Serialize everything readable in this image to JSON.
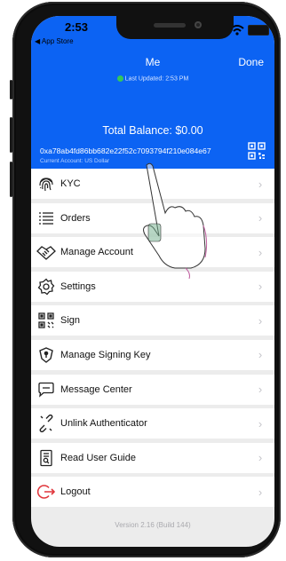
{
  "status_bar": {
    "time": "2:53",
    "back_app": "◀ App Store"
  },
  "nav": {
    "title": "Me",
    "done_label": "Done"
  },
  "header": {
    "last_updated": "Last Updated: 2:53 PM",
    "total_balance": "Total Balance: $0.00",
    "address": "0xa78ab4fd86bb682e22f52c7093794f210e084e67",
    "current_account": "Current Account: US Dollar"
  },
  "menu": {
    "items": [
      {
        "label": "KYC",
        "icon": "fingerprint-icon"
      },
      {
        "label": "Orders",
        "icon": "list-icon"
      },
      {
        "label": "Manage Account",
        "icon": "handshake-icon"
      },
      {
        "label": "Settings",
        "icon": "gear-icon"
      },
      {
        "label": "Sign",
        "icon": "qr-scan-icon"
      },
      {
        "label": "Manage Signing Key",
        "icon": "key-shield-icon"
      },
      {
        "label": "Message Center",
        "icon": "message-icon"
      },
      {
        "label": "Unlink Authenticator",
        "icon": "unlink-icon"
      },
      {
        "label": "Read User Guide",
        "icon": "guide-icon"
      },
      {
        "label": "Logout",
        "icon": "logout-icon"
      }
    ]
  },
  "footer": {
    "version": "Version 2.16 (Build 144)"
  },
  "colors": {
    "header_blue": "#0c63f3",
    "logout_red": "#e0353b",
    "online_green": "#35c759"
  }
}
